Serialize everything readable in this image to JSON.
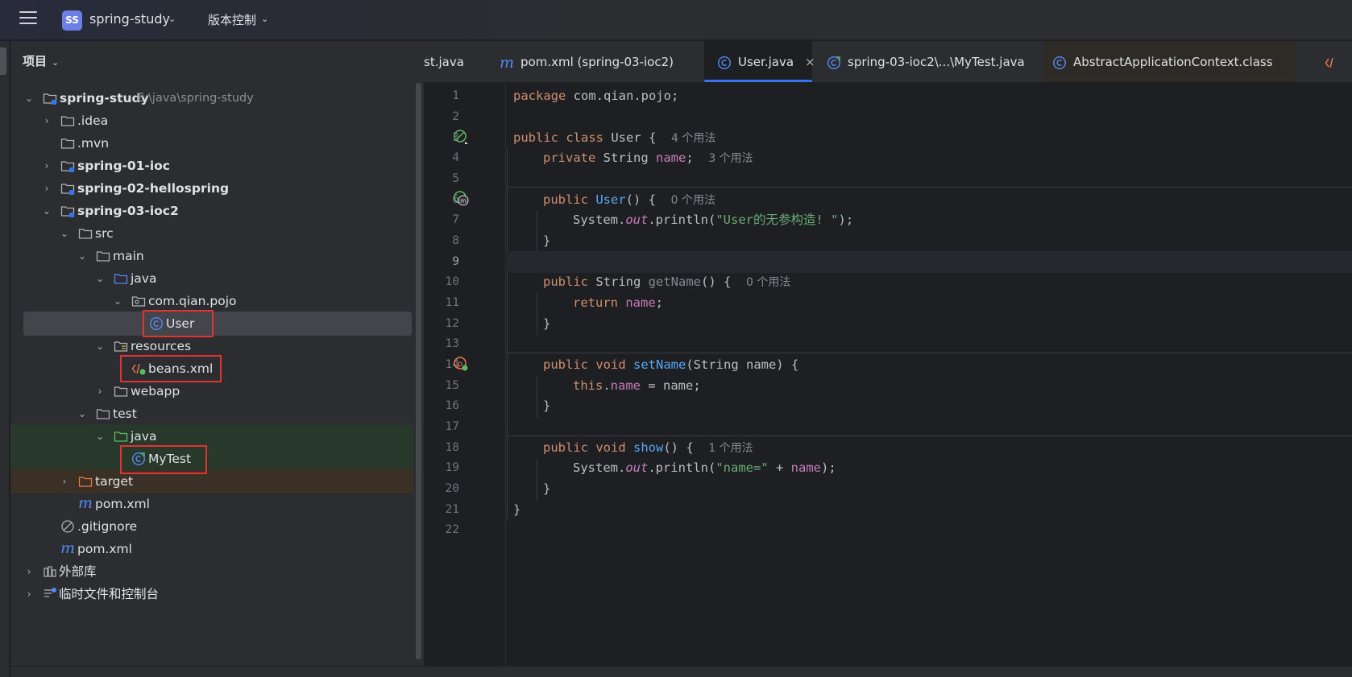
{
  "titlebar": {
    "project_badge": "SS",
    "project_name": "spring-study",
    "vcs_label": "版本控制"
  },
  "panel": {
    "title": "项目",
    "tree": [
      {
        "label": "spring-study",
        "path": "E:\\java\\spring-study",
        "icon": "module-folder-icon",
        "bold": true
      },
      {
        "label": ".idea",
        "icon": "folder-icon"
      },
      {
        "label": ".mvn",
        "icon": "folder-icon"
      },
      {
        "label": "spring-01-ioc",
        "icon": "module-folder-icon",
        "bold": true
      },
      {
        "label": "spring-02-hellospring",
        "icon": "module-folder-icon",
        "bold": true
      },
      {
        "label": "spring-03-ioc2",
        "icon": "module-folder-icon",
        "bold": true
      },
      {
        "label": "src",
        "icon": "folder-icon"
      },
      {
        "label": "main",
        "icon": "folder-icon"
      },
      {
        "label": "java",
        "icon": "source-folder-icon"
      },
      {
        "label": "com.qian.pojo",
        "icon": "package-icon"
      },
      {
        "label": "User",
        "icon": "class-icon"
      },
      {
        "label": "resources",
        "icon": "resources-folder-icon"
      },
      {
        "label": "beans.xml",
        "icon": "xml-file-icon"
      },
      {
        "label": "webapp",
        "icon": "folder-icon"
      },
      {
        "label": "test",
        "icon": "folder-icon"
      },
      {
        "label": "java",
        "icon": "test-source-folder-icon"
      },
      {
        "label": "MyTest",
        "icon": "test-class-icon"
      },
      {
        "label": "target",
        "icon": "excluded-folder-icon"
      },
      {
        "label": "pom.xml",
        "icon": "maven-icon"
      },
      {
        "label": ".gitignore",
        "icon": "ignore-file-icon"
      },
      {
        "label": "pom.xml",
        "icon": "maven-icon"
      },
      {
        "label": "外部库",
        "icon": "library-icon"
      },
      {
        "label": "临时文件和控制台",
        "icon": "scratch-icon"
      }
    ]
  },
  "tabs": [
    {
      "label": "st.java",
      "icon": "none"
    },
    {
      "label": "pom.xml (spring-03-ioc2)",
      "icon": "maven-icon"
    },
    {
      "label": "User.java",
      "icon": "class-icon",
      "active": true,
      "close": "×"
    },
    {
      "label": "spring-03-ioc2\\...\\MyTest.java",
      "icon": "test-class-icon"
    },
    {
      "label": "AbstractApplicationContext.class",
      "icon": "class-icon"
    },
    {
      "label": "",
      "icon": "xml-file-icon"
    }
  ],
  "editor": {
    "current_line": 9,
    "line_numbers": [
      "1",
      "2",
      "3",
      "4",
      "5",
      "6",
      "7",
      "8",
      "9",
      "10",
      "11",
      "12",
      "13",
      "14",
      "15",
      "16",
      "17",
      "18",
      "19",
      "20",
      "21",
      "22"
    ],
    "code": {
      "l1_kw": "package",
      "l1_rest": " com.qian.pojo;",
      "l3_kw": "public class",
      "l3_name": " User {",
      "l3_hint": "4 个用法",
      "l4_kw": "private",
      "l4_type": " String ",
      "l4_field": "name",
      "l4_semi": ";",
      "l4_hint": "3 个用法",
      "l6_kw": "public",
      "l6_fn": "User",
      "l6_rest": "() {",
      "l6_hint": "0 个用法",
      "l7_pre": "System.",
      "l7_it": "out",
      "l7_mid": ".println(",
      "l7_str": "\"User的无参构造! \"",
      "l7_end": ");",
      "brace_close": "}",
      "l10_kw": "public",
      "l10_type": " String ",
      "l10_fn": "getName",
      "l10_rest": "() {",
      "l10_hint": "0 个用法",
      "l11_kw": "return",
      "l11_field": "name",
      "l11_semi": ";",
      "l14_kw": "public void",
      "l14_fn": "setName",
      "l14_rest": "(String name) {",
      "l15_kw": "this",
      "l15_dot": ".",
      "l15_field": "name",
      "l15_rest": " = name;",
      "l18_kw": "public void",
      "l18_fn": "show",
      "l18_rest": "() {",
      "l18_hint": "1 个用法",
      "l19_pre": "System.",
      "l19_it": "out",
      "l19_mid": ".println(",
      "l19_str": "\"name=\"",
      "l19_plus": " + ",
      "l19_field": "name",
      "l19_end": ");"
    }
  },
  "colors": {
    "accent": "#3574f0",
    "highlight_box": "#e03333",
    "keyword": "#cf8e6d",
    "function": "#56a8f5",
    "field": "#c77dbb",
    "string": "#6aab73"
  }
}
